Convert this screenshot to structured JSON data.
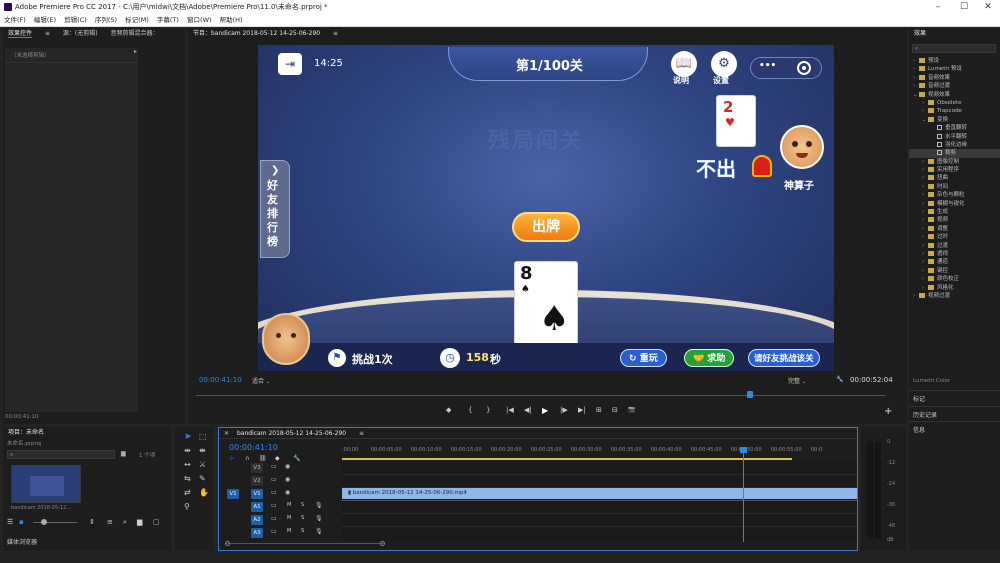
{
  "window": {
    "title": "Adobe Premiere Pro CC 2017 - C:\\用户\\midwi\\文档\\Adobe\\Premiere Pro\\11.0\\未命名.prproj *",
    "controls": [
      "–",
      "☐",
      "✕"
    ]
  },
  "menu": [
    "文件(F)",
    "编辑(E)",
    "剪辑(C)",
    "序列(S)",
    "标记(M)",
    "字幕(T)",
    "窗口(W)",
    "帮助(H)"
  ],
  "left_panel": {
    "tabs": [
      "效果控件",
      "≡",
      "源：(无剪辑)",
      "音频剪辑混合器："
    ],
    "empty_label": "（未选择剪辑）",
    "timecode": "00:00:41:10"
  },
  "program_monitor": {
    "tab": "节目：bandicam 2018-05-12 14-25-06-290",
    "timecode_left": "00:00:41:10",
    "fit": "适合",
    "quality": "完整",
    "timecode_right": "00:00:52:04",
    "controls": [
      "◆",
      "{",
      "}",
      "|◀",
      "◀|",
      "▶",
      "|▶",
      "▶|",
      "⊞",
      "⊟",
      "📷"
    ],
    "add": "+"
  },
  "game": {
    "time": "14:25",
    "level": "第1/100关",
    "help": "说明",
    "settings": "设置",
    "menu_dots": "•••",
    "watermark": "残局闯关",
    "side_label": "好友排行榜",
    "side_arrow": "❯",
    "opponent_card_rank": "2",
    "opponent_card_suit": "♥",
    "pass_label": "不出",
    "opponent_name": "神算子",
    "play_button": "出牌",
    "player_card_rank": "8",
    "player_card_suit": "♠",
    "challenge": "挑战1次",
    "seconds": "158",
    "seconds_unit": "秒",
    "replay": "重玩",
    "help_request": "求助",
    "invite": "请好友挑战该关"
  },
  "project_panel": {
    "tab": "项目：未命名",
    "file": "未命名.prproj",
    "item_count": "1 个项",
    "clip_name": "bandicam 2018-05-12...",
    "footer_label": "媒体浏览器"
  },
  "timeline": {
    "tab": "bandicam 2018-05-12 14-25-06-290",
    "timecode": "00:00:41:10",
    "ruler": [
      ":00:00",
      "00:00:05:00",
      "00:00:10:00",
      "00:00:15:00",
      "00:00:20:00",
      "00:00:25:00",
      "00:00:30:00",
      "00:00:35:00",
      "00:00:40:00",
      "00:00:45:00",
      "00:00:50:00",
      "00:00:55:00",
      "00:0"
    ],
    "tracks": [
      {
        "name": "V3"
      },
      {
        "name": "V2"
      },
      {
        "name": "V1",
        "source": "V1"
      },
      {
        "name": "A1",
        "source": "A1"
      },
      {
        "name": "A2"
      },
      {
        "name": "A3"
      }
    ],
    "clip": "bandicam 2018-05-12 14-25-06-290.mp4",
    "playhead_fraction": 0.779
  },
  "meters": [
    "0",
    "-12",
    "-24",
    "-36",
    "-48",
    "dB"
  ],
  "effects_panel": {
    "tab": "效果",
    "items": [
      {
        "label": "预设",
        "level": 0,
        "type": "folder"
      },
      {
        "label": "Lumetri 预设",
        "level": 0,
        "type": "folder"
      },
      {
        "label": "音频效果",
        "level": 0,
        "type": "folder"
      },
      {
        "label": "音频过渡",
        "level": 0,
        "type": "folder"
      },
      {
        "label": "视频效果",
        "level": 0,
        "type": "folder",
        "open": true
      },
      {
        "label": "Obsolete",
        "level": 1,
        "type": "folder"
      },
      {
        "label": "Trapcode",
        "level": 1,
        "type": "folder"
      },
      {
        "label": "变换",
        "level": 1,
        "type": "folder",
        "open": true
      },
      {
        "label": "垂直翻转",
        "level": 2,
        "type": "doc"
      },
      {
        "label": "水平翻转",
        "level": 2,
        "type": "doc"
      },
      {
        "label": "羽化边缘",
        "level": 2,
        "type": "doc"
      },
      {
        "label": "裁剪",
        "level": 2,
        "type": "doc",
        "selected": true
      },
      {
        "label": "图像控制",
        "level": 1,
        "type": "folder"
      },
      {
        "label": "实用程序",
        "level": 1,
        "type": "folder"
      },
      {
        "label": "扭曲",
        "level": 1,
        "type": "folder"
      },
      {
        "label": "时间",
        "level": 1,
        "type": "folder"
      },
      {
        "label": "杂色与颗粒",
        "level": 1,
        "type": "folder"
      },
      {
        "label": "模糊与锐化",
        "level": 1,
        "type": "folder"
      },
      {
        "label": "生成",
        "level": 1,
        "type": "folder"
      },
      {
        "label": "视频",
        "level": 1,
        "type": "folder"
      },
      {
        "label": "调整",
        "level": 1,
        "type": "folder"
      },
      {
        "label": "过时",
        "level": 1,
        "type": "folder"
      },
      {
        "label": "过渡",
        "level": 1,
        "type": "folder"
      },
      {
        "label": "透视",
        "level": 1,
        "type": "folder"
      },
      {
        "label": "通道",
        "level": 1,
        "type": "folder"
      },
      {
        "label": "键控",
        "level": 1,
        "type": "folder"
      },
      {
        "label": "颜色校正",
        "level": 1,
        "type": "folder"
      },
      {
        "label": "风格化",
        "level": 1,
        "type": "folder"
      },
      {
        "label": "视频过渡",
        "level": 0,
        "type": "folder"
      }
    ],
    "lumetri_color": "Lumetri Color",
    "markers": "标记",
    "history": "历史记录",
    "info": "信息"
  },
  "colors": {
    "accent": "#2d8ceb",
    "clip": "#8fb6e8",
    "folder": "#c8a94c",
    "timeline_border": "#3a7bd5"
  }
}
